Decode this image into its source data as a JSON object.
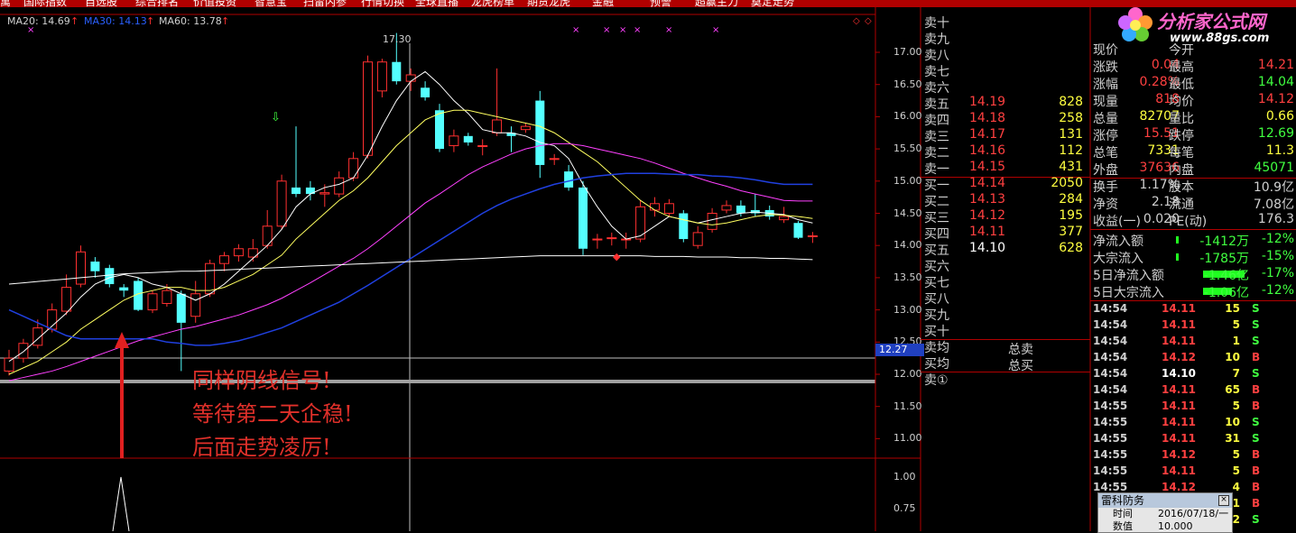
{
  "menu": [
    "寓",
    "国际指数",
    "自选股",
    "综合排名",
    "价值投资",
    "智慧宝",
    "扫雷内参",
    "行情切换",
    "全球直播",
    "龙虎榜单",
    "期货龙虎",
    "金融",
    "预警",
    "超赢主力",
    "奠定走势"
  ],
  "ma_legend": {
    "ma20": "MA20: 14.69",
    "ma30": "MA30: 14.13",
    "ma60": "MA60: 13.78",
    "arrow": "↑",
    "colors": {
      "ma20": "#d0d0d0",
      "ma30": "#2a60ff",
      "ma60": "#d0d0d0"
    }
  },
  "chart": {
    "high_label": "17.30",
    "y_ticks": [
      "17.00",
      "16.50",
      "16.00",
      "15.50",
      "15.00",
      "14.50",
      "14.00",
      "13.50",
      "13.00",
      "12.50",
      "12.00",
      "11.50",
      "11.00"
    ],
    "current_price_tag": "12.27",
    "lower_ticks": [
      "1.00",
      "0.75"
    ],
    "annotation": [
      "同样阴线信号!",
      "等待第二天企稳!",
      "后面走势凌厉!"
    ]
  },
  "order_book": {
    "sell_empty": [
      "卖十",
      "卖九",
      "卖八",
      "卖七",
      "卖六"
    ],
    "sell": [
      {
        "label": "卖五",
        "price": "14.19",
        "vol": "828"
      },
      {
        "label": "卖四",
        "price": "14.18",
        "vol": "258"
      },
      {
        "label": "卖三",
        "price": "14.17",
        "vol": "131"
      },
      {
        "label": "卖二",
        "price": "14.16",
        "vol": "112"
      },
      {
        "label": "卖一",
        "price": "14.15",
        "vol": "431"
      }
    ],
    "buy": [
      {
        "label": "买一",
        "price": "14.14",
        "vol": "2050"
      },
      {
        "label": "买二",
        "price": "14.13",
        "vol": "284"
      },
      {
        "label": "买三",
        "price": "14.12",
        "vol": "195"
      },
      {
        "label": "买四",
        "price": "14.11",
        "vol": "377"
      },
      {
        "label": "买五",
        "price": "14.10",
        "vol": "628"
      }
    ],
    "buy_empty": [
      "买六",
      "买七",
      "买八",
      "买九",
      "买十"
    ],
    "avg_sell": "卖均",
    "avg_buy": "买均",
    "total_sell": "总卖",
    "total_buy": "总买",
    "sell_1": "卖①"
  },
  "quote": [
    {
      "l1": "现价",
      "v1": "",
      "l2": "今开",
      "v2": ""
    },
    {
      "l1": "涨跌",
      "v1": "0.04",
      "l2": "最高",
      "v2": "14.21"
    },
    {
      "l1": "涨幅",
      "v1": "0.28%",
      "l2": "最低",
      "v2": "14.04"
    },
    {
      "l1": "现量",
      "v1": "818",
      "l2": "均价",
      "v2": "14.12"
    },
    {
      "l1": "总量",
      "v1": "82707",
      "l2": "量比",
      "v2": "0.66"
    },
    {
      "l1": "涨停",
      "v1": "15.51",
      "l2": "跌停",
      "v2": "12.69"
    },
    {
      "l1": "总笔",
      "v1": "7331",
      "l2": "每笔",
      "v2": "11.3"
    },
    {
      "l1": "外盘",
      "v1": "37636",
      "l2": "内盘",
      "v2": "45071"
    },
    {
      "l1": "换手",
      "v1": "1.17%",
      "l2": "股本",
      "v2": "10.9亿"
    },
    {
      "l1": "净资",
      "v1": "2.18",
      "l2": "流通",
      "v2": "7.08亿"
    },
    {
      "l1": "收益(一)",
      "v1": "0.020",
      "l2": "PE(动)",
      "v2": "176.3"
    }
  ],
  "flow": [
    {
      "label": "净流入额",
      "v1": "-1412万",
      "v2": "-12%"
    },
    {
      "label": "大宗流入",
      "v1": "-1785万",
      "v2": "-15%"
    },
    {
      "label": "5日净流入额",
      "v1": "-1.46亿",
      "v2": "-17%"
    },
    {
      "label": "5日大宗流入",
      "v1": "-1.06亿",
      "v2": "-12%"
    }
  ],
  "ticks": [
    {
      "t": "14:54",
      "p": "14.11",
      "v": "15",
      "s": "S"
    },
    {
      "t": "14:54",
      "p": "14.11",
      "v": "5",
      "s": "S"
    },
    {
      "t": "14:54",
      "p": "14.11",
      "v": "1",
      "s": "S"
    },
    {
      "t": "14:54",
      "p": "14.12",
      "v": "10",
      "s": "B"
    },
    {
      "t": "14:54",
      "p": "14.10",
      "v": "7",
      "s": "S"
    },
    {
      "t": "14:54",
      "p": "14.11",
      "v": "65",
      "s": "B"
    },
    {
      "t": "14:55",
      "p": "14.11",
      "v": "5",
      "s": "B"
    },
    {
      "t": "14:55",
      "p": "14.11",
      "v": "10",
      "s": "S"
    },
    {
      "t": "14:55",
      "p": "14.11",
      "v": "31",
      "s": "S"
    },
    {
      "t": "14:55",
      "p": "14.12",
      "v": "5",
      "s": "B"
    },
    {
      "t": "14:55",
      "p": "14.11",
      "v": "5",
      "s": "B"
    },
    {
      "t": "14:55",
      "p": "14.12",
      "v": "4",
      "s": "B"
    },
    {
      "t": "",
      "p": "",
      "v": "21",
      "s": "B"
    },
    {
      "t": "",
      "p": "",
      "v": "12",
      "s": "S"
    }
  ],
  "logo": {
    "text": "分析家公式网",
    "url": "www.88gs.com"
  },
  "popup": {
    "title": "雷科防务",
    "time_label": "时间",
    "time_value": "2016/07/18/一",
    "value_label": "数值",
    "value_value": "10.000"
  },
  "candles": [
    {
      "o": 12.05,
      "c": 12.25,
      "h": 12.38,
      "l": 11.98
    },
    {
      "o": 12.25,
      "c": 12.48,
      "h": 12.55,
      "l": 12.18
    },
    {
      "o": 12.45,
      "c": 12.72,
      "h": 12.85,
      "l": 12.4
    },
    {
      "o": 12.7,
      "c": 13.0,
      "h": 13.1,
      "l": 12.65
    },
    {
      "o": 12.98,
      "c": 13.35,
      "h": 13.55,
      "l": 12.92
    },
    {
      "o": 13.4,
      "c": 13.9,
      "h": 14.0,
      "l": 13.35
    },
    {
      "o": 13.75,
      "c": 13.6,
      "h": 13.82,
      "l": 13.5
    },
    {
      "o": 13.65,
      "c": 13.4,
      "h": 13.7,
      "l": 13.35
    },
    {
      "o": 13.35,
      "c": 13.3,
      "h": 13.4,
      "l": 13.2
    },
    {
      "o": 13.45,
      "c": 13.0,
      "h": 13.5,
      "l": 12.98
    },
    {
      "o": 13.0,
      "c": 13.25,
      "h": 13.3,
      "l": 12.95
    },
    {
      "o": 13.1,
      "c": 13.3,
      "h": 13.4,
      "l": 13.05
    },
    {
      "o": 13.25,
      "c": 12.8,
      "h": 13.3,
      "l": 12.05
    },
    {
      "o": 12.9,
      "c": 13.25,
      "h": 13.45,
      "l": 12.8
    },
    {
      "o": 13.25,
      "c": 13.72,
      "h": 13.78,
      "l": 13.2
    },
    {
      "o": 13.72,
      "c": 13.84,
      "h": 13.9,
      "l": 13.6
    },
    {
      "o": 13.84,
      "c": 13.95,
      "h": 14.02,
      "l": 13.75
    },
    {
      "o": 13.82,
      "c": 13.95,
      "h": 14.1,
      "l": 13.75
    },
    {
      "o": 14.0,
      "c": 14.3,
      "h": 14.55,
      "l": 13.95
    },
    {
      "o": 14.3,
      "c": 15.0,
      "h": 15.1,
      "l": 14.25
    },
    {
      "o": 14.9,
      "c": 14.8,
      "h": 15.85,
      "l": 14.75
    },
    {
      "o": 14.9,
      "c": 14.8,
      "h": 15.0,
      "l": 14.7
    },
    {
      "o": 14.8,
      "c": 14.82,
      "h": 14.95,
      "l": 14.6
    },
    {
      "o": 14.8,
      "c": 15.05,
      "h": 15.15,
      "l": 14.75
    },
    {
      "o": 15.05,
      "c": 15.35,
      "h": 15.45,
      "l": 15.0
    },
    {
      "o": 15.4,
      "c": 16.85,
      "h": 16.95,
      "l": 15.35
    },
    {
      "o": 16.4,
      "c": 16.85,
      "h": 16.9,
      "l": 16.3
    },
    {
      "o": 16.85,
      "c": 16.55,
      "h": 17.3,
      "l": 16.5
    },
    {
      "o": 16.55,
      "c": 16.65,
      "h": 16.75,
      "l": 16.4
    },
    {
      "o": 16.45,
      "c": 16.3,
      "h": 16.55,
      "l": 16.25
    },
    {
      "o": 16.1,
      "c": 15.5,
      "h": 16.2,
      "l": 15.45
    },
    {
      "o": 15.55,
      "c": 15.7,
      "h": 15.8,
      "l": 15.45
    },
    {
      "o": 15.7,
      "c": 15.6,
      "h": 15.75,
      "l": 15.55
    },
    {
      "o": 15.55,
      "c": 15.55,
      "h": 15.65,
      "l": 15.4
    },
    {
      "o": 15.75,
      "c": 15.95,
      "h": 16.75,
      "l": 15.7
    },
    {
      "o": 15.75,
      "c": 15.7,
      "h": 15.85,
      "l": 15.45
    },
    {
      "o": 15.8,
      "c": 15.85,
      "h": 15.9,
      "l": 15.75
    },
    {
      "o": 16.25,
      "c": 15.25,
      "h": 16.4,
      "l": 15.05
    },
    {
      "o": 15.35,
      "c": 15.35,
      "h": 15.42,
      "l": 15.25
    },
    {
      "o": 15.15,
      "c": 14.9,
      "h": 15.25,
      "l": 14.85
    },
    {
      "o": 14.9,
      "c": 13.95,
      "h": 15.0,
      "l": 13.85
    },
    {
      "o": 14.1,
      "c": 14.1,
      "h": 14.18,
      "l": 13.95
    },
    {
      "o": 14.12,
      "c": 14.12,
      "h": 14.2,
      "l": 14.0
    },
    {
      "o": 14.1,
      "c": 14.1,
      "h": 14.2,
      "l": 13.95
    },
    {
      "o": 14.1,
      "c": 14.6,
      "h": 14.7,
      "l": 14.05
    },
    {
      "o": 14.55,
      "c": 14.65,
      "h": 14.75,
      "l": 14.45
    },
    {
      "o": 14.5,
      "c": 14.65,
      "h": 14.72,
      "l": 14.45
    },
    {
      "o": 14.5,
      "c": 14.1,
      "h": 14.55,
      "l": 14.05
    },
    {
      "o": 14.0,
      "c": 14.2,
      "h": 14.3,
      "l": 13.95
    },
    {
      "o": 14.25,
      "c": 14.5,
      "h": 14.58,
      "l": 14.2
    },
    {
      "o": 14.55,
      "c": 14.62,
      "h": 14.7,
      "l": 14.5
    },
    {
      "o": 14.62,
      "c": 14.5,
      "h": 14.7,
      "l": 14.45
    },
    {
      "o": 14.55,
      "c": 14.5,
      "h": 14.8,
      "l": 14.45
    },
    {
      "o": 14.55,
      "c": 14.45,
      "h": 14.62,
      "l": 14.4
    },
    {
      "o": 14.4,
      "c": 14.45,
      "h": 14.6,
      "l": 14.35
    },
    {
      "o": 14.35,
      "c": 14.12,
      "h": 14.38,
      "l": 14.1
    },
    {
      "o": 14.15,
      "c": 14.15,
      "h": 14.21,
      "l": 14.04
    }
  ],
  "ma_lines": {
    "ma5": [
      12.2,
      12.35,
      12.55,
      12.75,
      12.95,
      13.2,
      13.4,
      13.5,
      13.55,
      13.5,
      13.4,
      13.35,
      13.25,
      13.15,
      13.25,
      13.4,
      13.6,
      13.8,
      14.0,
      14.25,
      14.6,
      14.8,
      14.9,
      14.95,
      15.05,
      15.4,
      15.85,
      16.25,
      16.55,
      16.7,
      16.5,
      16.25,
      16.05,
      15.8,
      15.75,
      15.75,
      15.7,
      15.6,
      15.55,
      15.35,
      14.95,
      14.6,
      14.3,
      14.1,
      14.15,
      14.3,
      14.45,
      14.4,
      14.35,
      14.4,
      14.45,
      14.5,
      14.52,
      14.5,
      14.48,
      14.4,
      14.35
    ],
    "ma10": [
      12.0,
      12.1,
      12.2,
      12.35,
      12.5,
      12.7,
      12.85,
      13.0,
      13.15,
      13.25,
      13.3,
      13.35,
      13.35,
      13.3,
      13.3,
      13.35,
      13.45,
      13.55,
      13.7,
      13.85,
      14.1,
      14.3,
      14.5,
      14.7,
      14.85,
      15.05,
      15.3,
      15.55,
      15.75,
      15.95,
      16.05,
      16.1,
      16.1,
      16.05,
      16.0,
      15.95,
      15.9,
      15.85,
      15.75,
      15.6,
      15.45,
      15.3,
      15.1,
      14.9,
      14.7,
      14.55,
      14.45,
      14.4,
      14.35,
      14.32,
      14.35,
      14.4,
      14.45,
      14.48,
      14.47,
      14.45,
      14.42
    ],
    "ma20": [
      11.9,
      11.95,
      12.0,
      12.05,
      12.12,
      12.2,
      12.28,
      12.36,
      12.44,
      12.52,
      12.58,
      12.64,
      12.7,
      12.74,
      12.8,
      12.86,
      12.92,
      13.0,
      13.08,
      13.18,
      13.3,
      13.42,
      13.55,
      13.68,
      13.8,
      13.95,
      14.12,
      14.3,
      14.48,
      14.66,
      14.8,
      14.95,
      15.1,
      15.22,
      15.32,
      15.42,
      15.5,
      15.55,
      15.58,
      15.58,
      15.55,
      15.5,
      15.45,
      15.4,
      15.35,
      15.28,
      15.2,
      15.12,
      15.05,
      14.98,
      14.92,
      14.85,
      14.8,
      14.75,
      14.7,
      14.69,
      14.69
    ],
    "ma30": [
      13.0,
      12.9,
      12.8,
      12.7,
      12.6,
      12.55,
      12.55,
      12.55,
      12.55,
      12.55,
      12.55,
      12.5,
      12.48,
      12.45,
      12.45,
      12.48,
      12.52,
      12.58,
      12.65,
      12.72,
      12.82,
      12.92,
      13.02,
      13.12,
      13.25,
      13.38,
      13.52,
      13.66,
      13.8,
      13.94,
      14.08,
      14.22,
      14.36,
      14.5,
      14.62,
      14.72,
      14.8,
      14.88,
      14.95,
      15.0,
      15.05,
      15.08,
      15.1,
      15.12,
      15.12,
      15.12,
      15.11,
      15.1,
      15.1,
      15.08,
      15.07,
      15.05,
      15.02,
      14.98,
      14.95,
      14.95,
      14.95
    ],
    "ma60": [
      13.4,
      13.42,
      13.44,
      13.46,
      13.48,
      13.5,
      13.52,
      13.54,
      13.56,
      13.57,
      13.58,
      13.59,
      13.6,
      13.6,
      13.61,
      13.62,
      13.63,
      13.64,
      13.65,
      13.66,
      13.67,
      13.68,
      13.69,
      13.7,
      13.71,
      13.72,
      13.73,
      13.74,
      13.75,
      13.76,
      13.77,
      13.78,
      13.79,
      13.8,
      13.81,
      13.82,
      13.83,
      13.84,
      13.84,
      13.84,
      13.84,
      13.84,
      13.84,
      13.84,
      13.84,
      13.83,
      13.83,
      13.83,
      13.82,
      13.82,
      13.82,
      13.81,
      13.81,
      13.8,
      13.8,
      13.79,
      13.78
    ]
  },
  "ma_colors": {
    "ma5": "#ffffff",
    "ma10": "#ffff60",
    "ma20": "#ff40ff",
    "ma30": "#2040e0",
    "ma60": "#ffffff"
  }
}
